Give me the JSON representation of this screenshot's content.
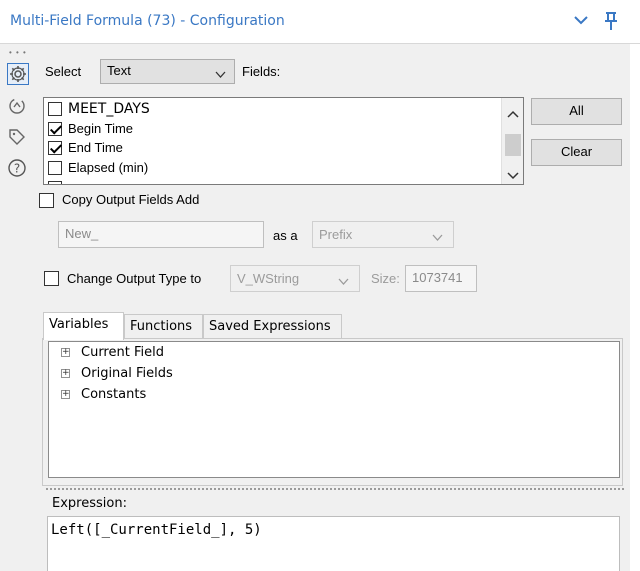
{
  "window": {
    "title": "Multi-Field Formula (73) - Configuration",
    "accent": "#3a78c4"
  },
  "sidebar": {
    "icons": [
      "gear-icon",
      "arrow-circle-icon",
      "tag-icon",
      "help-icon"
    ]
  },
  "select": {
    "label": "Select",
    "value": "Text",
    "fields_label": "Fields:"
  },
  "fields": {
    "items": [
      {
        "label": "MEET_DAYS",
        "checked": false
      },
      {
        "label": "Begin Time",
        "checked": true
      },
      {
        "label": "End Time",
        "checked": true
      },
      {
        "label": "Elapsed (min)",
        "checked": false
      }
    ]
  },
  "buttons": {
    "all": "All",
    "clear": "Clear"
  },
  "copy_output": {
    "label": "Copy Output Fields Add",
    "checked": false,
    "input_value": "New_",
    "as_a_label": "as a",
    "position_value": "Prefix"
  },
  "change_type": {
    "label": "Change Output Type to",
    "checked": false,
    "type_value": "V_WString",
    "size_label": "Size:",
    "size_value": "1073741"
  },
  "tabs": [
    {
      "label": "Variables",
      "active": true
    },
    {
      "label": "Functions",
      "active": false
    },
    {
      "label": "Saved Expressions",
      "active": false
    }
  ],
  "tree": {
    "items": [
      "Current Field",
      "Original Fields",
      "Constants"
    ]
  },
  "expression": {
    "label": "Expression:",
    "code": "Left([_CurrentField_], 5)"
  }
}
